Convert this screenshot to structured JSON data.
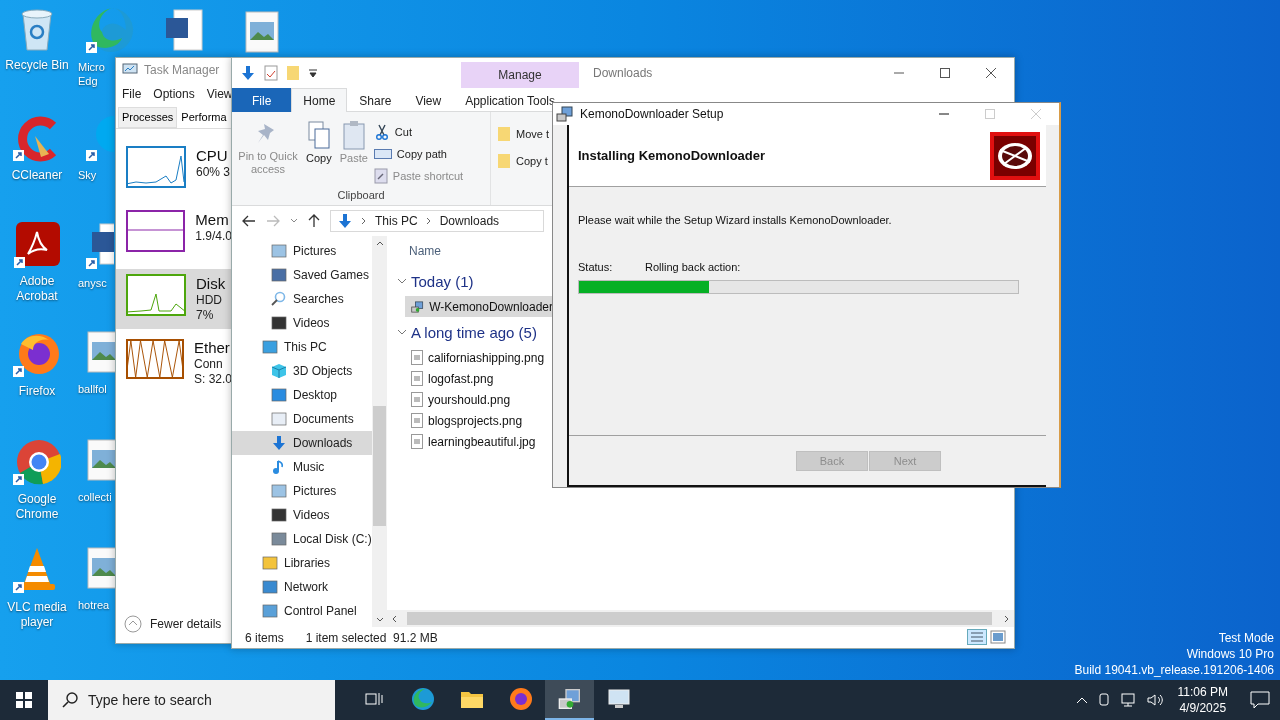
{
  "desktop": {
    "icons": [
      {
        "label": "Recycle Bin"
      },
      {
        "label": "CCleaner"
      },
      {
        "label": "Adobe Acrobat"
      },
      {
        "label": "Firefox"
      },
      {
        "label": "Google Chrome"
      },
      {
        "label": "VLC media player"
      }
    ],
    "partial_icons": [
      {
        "label": "Micro\nEdg"
      },
      {
        "label": "Sky"
      },
      {
        "label": "anysc"
      },
      {
        "label": "ballfol"
      },
      {
        "label": "collecti"
      },
      {
        "label": "hotrea"
      }
    ],
    "os_watermark": [
      "Test Mode",
      "Windows 10 Pro",
      "Build 19041.vb_release.191206-1406"
    ]
  },
  "task_manager": {
    "title": "Task Manager",
    "menu": [
      "File",
      "Options",
      "View"
    ],
    "tabs": [
      {
        "label": "Processes",
        "selected": false
      },
      {
        "label": "Performa",
        "selected": true
      }
    ],
    "resources": [
      {
        "name": "CPU",
        "lines": [
          "60% 3"
        ],
        "selected": false,
        "color": "#1a7ec4"
      },
      {
        "name": "Mem",
        "lines": [
          "1.9/4.0"
        ],
        "selected": false,
        "color": "#8b24a8"
      },
      {
        "name": "Disk",
        "lines": [
          "HDD",
          "7%"
        ],
        "selected": true,
        "color": "#4da60c"
      },
      {
        "name": "Ether",
        "lines": [
          "Conn",
          "S: 32.0"
        ],
        "selected": false,
        "color": "#a74f01"
      }
    ],
    "footer": "Fewer details"
  },
  "explorer": {
    "title": "Downloads",
    "context_tab": "Manage",
    "tabs": [
      {
        "label": "File",
        "selected": false,
        "kind": "file"
      },
      {
        "label": "Home",
        "selected": true,
        "kind": "tab"
      },
      {
        "label": "Share",
        "selected": false,
        "kind": "tab"
      },
      {
        "label": "View",
        "selected": false,
        "kind": "tab"
      },
      {
        "label": "Application Tools",
        "selected": false,
        "kind": "tab"
      }
    ],
    "commands": [
      {
        "label": "Pin to Quick access",
        "kind": "large",
        "disabled": true
      },
      {
        "label": "Copy",
        "kind": "large",
        "disabled": false
      },
      {
        "label": "Paste",
        "kind": "large",
        "disabled": true
      },
      {
        "label": "Cut",
        "kind": "small",
        "disabled": false
      },
      {
        "label": "Copy path",
        "kind": "small",
        "disabled": false
      },
      {
        "label": "Paste shortcut",
        "kind": "small",
        "disabled": true
      }
    ],
    "group_label": "Clipboard",
    "organize": [
      "Move t",
      "Copy t"
    ],
    "breadcrumb": [
      "This PC",
      "Downloads"
    ],
    "nav_tree": [
      {
        "children": [
          {
            "label": "Pictures",
            "selected": false
          },
          {
            "label": "Saved Games",
            "selected": false
          },
          {
            "label": "Searches",
            "selected": false
          },
          {
            "label": "Videos",
            "selected": false
          }
        ]
      },
      {
        "label": "This PC",
        "selected": false,
        "children": [
          {
            "label": "3D Objects",
            "selected": false
          },
          {
            "label": "Desktop",
            "selected": false
          },
          {
            "label": "Documents",
            "selected": false
          },
          {
            "label": "Downloads",
            "selected": true
          },
          {
            "label": "Music",
            "selected": false
          },
          {
            "label": "Pictures",
            "selected": false
          },
          {
            "label": "Videos",
            "selected": false
          },
          {
            "label": "Local Disk (C:)",
            "selected": false
          }
        ]
      },
      {
        "label": "Libraries",
        "selected": false
      },
      {
        "label": "Network",
        "selected": false
      },
      {
        "label": "Control Panel",
        "selected": false
      }
    ],
    "column_header": "Name",
    "groups": [
      {
        "label": "Today (1)",
        "expanded": true,
        "files": [
          {
            "name": "W-KemonoDownloader",
            "selected": true,
            "kind": "installer"
          }
        ]
      },
      {
        "label": "A long time ago (5)",
        "expanded": true,
        "files": [
          {
            "name": "californiashipping.png",
            "selected": false,
            "kind": "image"
          },
          {
            "name": "logofast.png",
            "selected": false,
            "kind": "image"
          },
          {
            "name": "yourshould.png",
            "selected": false,
            "kind": "image"
          },
          {
            "name": "blogsprojects.png",
            "selected": false,
            "kind": "image"
          },
          {
            "name": "learningbeautiful.jpg",
            "selected": false,
            "kind": "image"
          }
        ]
      }
    ],
    "status": {
      "count": "6 items",
      "selection": "1 item selected",
      "size": "91.2 MB"
    }
  },
  "setup": {
    "title": "KemonoDownloader Setup",
    "heading": "Installing KemonoDownloader",
    "message": "Please wait while the Setup Wizard installs KemonoDownloader.",
    "status_label": "Status:",
    "status_value": "Rolling back action:",
    "level": 0.295,
    "buttons": [
      {
        "label": "Back",
        "disabled": true
      },
      {
        "label": "Next",
        "disabled": true
      }
    ]
  },
  "taskbar": {
    "search_placeholder": "Type here to search",
    "apps": [
      {
        "active": false
      },
      {
        "active": false
      },
      {
        "active": false
      },
      {
        "active": false
      },
      {
        "active": true
      },
      {
        "active": false
      }
    ],
    "time": "11:06 PM",
    "date": "4/9/2025"
  }
}
